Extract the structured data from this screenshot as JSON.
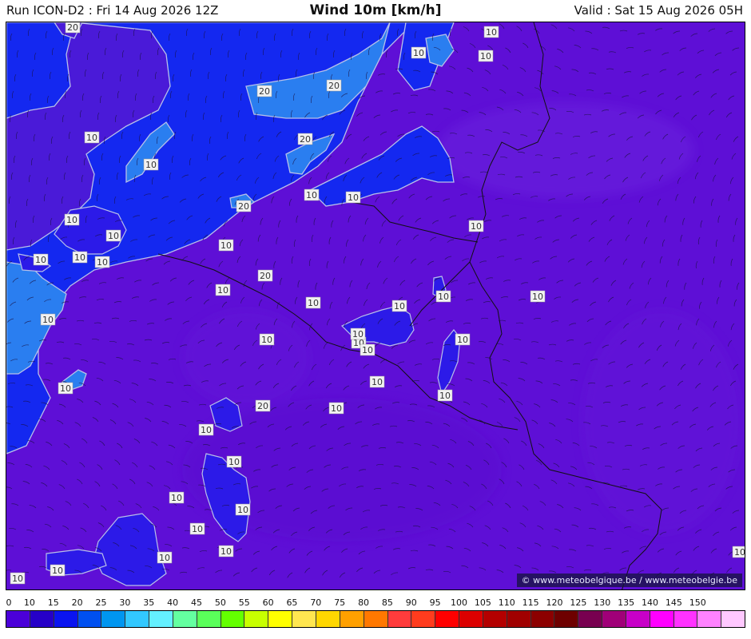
{
  "header": {
    "run": "Run ICON-D2 : Fri 14 Aug 2026 12Z",
    "title": "Wind 10m [km/h]",
    "valid": "Valid : Sat 15 Aug 2026 05H"
  },
  "credit": "© www.meteobelgique.be / www.meteobelgie.be",
  "contour_labels": [
    "20",
    "10",
    "10",
    "20",
    "20",
    "10",
    "20",
    "10",
    "10",
    "10",
    "20",
    "10",
    "10",
    "10",
    "10",
    "10",
    "10",
    "20",
    "10",
    "10",
    "10",
    "10",
    "10",
    "10",
    "10",
    "10",
    "10",
    "10",
    "10",
    "10",
    "20",
    "10",
    "10",
    "10",
    "10",
    "10",
    "10",
    "10",
    "10",
    "10",
    "10",
    "10",
    "10",
    "10",
    "10",
    "10"
  ],
  "scale": {
    "ticks": [
      "0",
      "10",
      "15",
      "20",
      "25",
      "30",
      "35",
      "40",
      "45",
      "50",
      "55",
      "60",
      "65",
      "70",
      "75",
      "80",
      "85",
      "90",
      "95",
      "100",
      "105",
      "110",
      "115",
      "120",
      "125",
      "130",
      "135",
      "140",
      "145",
      "150"
    ],
    "colors": [
      "#4b00d9",
      "#2600c8",
      "#0a14f0",
      "#0050f0",
      "#0096f0",
      "#32c8ff",
      "#64f0ff",
      "#64ffa0",
      "#5aff5a",
      "#64ff00",
      "#c8ff00",
      "#ffff00",
      "#ffe650",
      "#ffd700",
      "#ffa000",
      "#ff7800",
      "#ff3c3c",
      "#ff3c1e",
      "#ff0000",
      "#dc0000",
      "#b40000",
      "#a00000",
      "#8c0000",
      "#6e0000",
      "#780050",
      "#a00078",
      "#c800c8",
      "#ff00ff",
      "#ff32ff",
      "#ff82ff",
      "#ffc8ff"
    ]
  },
  "legend_name": "wind-speed-scale"
}
